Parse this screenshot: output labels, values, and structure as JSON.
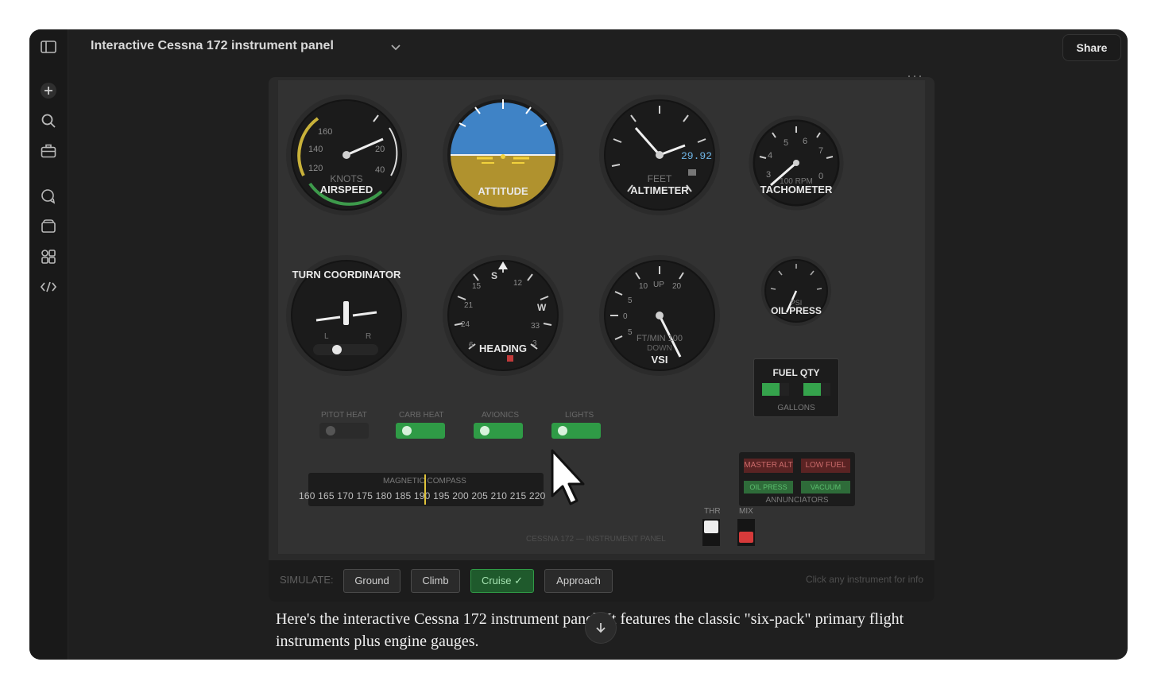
{
  "window": {
    "title": "Interactive Cessna 172 instrument panel",
    "share_label": "Share",
    "menu_dots": "···"
  },
  "sidebar": {
    "icons": [
      "sidebar-toggle-icon",
      "plus-icon",
      "search-icon",
      "briefcase-icon",
      "chat-icon",
      "folder-icon",
      "apps-icon",
      "code-icon"
    ]
  },
  "instruments": {
    "airspeed": {
      "label": "AIRSPEED",
      "unit": "KNOTS",
      "ticks": [
        "160",
        "140",
        "120",
        "20",
        "40"
      ]
    },
    "attitude": {
      "label": "ATTITUDE",
      "sky_color": "#3f83c6",
      "ground_color": "#b0922e"
    },
    "altimeter": {
      "label": "ALTIMETER",
      "unit": "FEET",
      "setting": "29.92"
    },
    "tachometer": {
      "label": "TACHOMETER",
      "unit": "100 RPM",
      "ticks": [
        "5",
        "6",
        "7",
        "4",
        "3",
        "0"
      ]
    },
    "turn_coordinator": {
      "label": "TURN COORDINATOR",
      "left": "L",
      "right": "R"
    },
    "heading": {
      "label": "HEADING",
      "ticks": [
        "S",
        "12",
        "15",
        "21",
        "24",
        "3",
        "W",
        "33",
        "6"
      ]
    },
    "vsi": {
      "label": "VSI",
      "unit": "FT/MIN 100",
      "sub": "DOWN",
      "ticks": [
        "10",
        "UP",
        "20",
        "5",
        "0",
        "5"
      ]
    },
    "oil_press": {
      "label": "OIL PRESS",
      "unit": "PSI"
    },
    "fuel_qty": {
      "label": "FUEL QTY",
      "unit": "GALLONS"
    }
  },
  "switches": [
    {
      "label": "PITOT HEAT",
      "on": false
    },
    {
      "label": "CARB HEAT",
      "on": true
    },
    {
      "label": "AVIONICS",
      "on": true
    },
    {
      "label": "LIGHTS",
      "on": true
    }
  ],
  "compass": {
    "label": "MAGNETIC COMPASS",
    "strip": "160 165 170 175 180 185 190 195 200 205 210 215 220"
  },
  "annunciators": {
    "label": "ANNUNCIATORS",
    "items": [
      {
        "label": "MASTER ALT",
        "color": "#5a2323"
      },
      {
        "label": "LOW FUEL",
        "color": "#5a2323"
      },
      {
        "label": "OIL PRESS",
        "color": "#2e6b39"
      },
      {
        "label": "VACUUM",
        "color": "#2e6b39"
      }
    ]
  },
  "levers": {
    "throttle": "THR",
    "mixture": "MIX"
  },
  "footer_label": "CESSNA 172 — INSTRUMENT PANEL",
  "simulate": {
    "label": "SIMULATE:",
    "buttons": [
      "Ground",
      "Climb",
      "Cruise ✓",
      "Approach"
    ],
    "active_index": 2,
    "hint": "Click any instrument for info"
  },
  "message": {
    "text": "Here's the interactive Cessna 172 instrument panel! It features the classic \"six-pack\" primary flight instruments plus engine gauges."
  }
}
